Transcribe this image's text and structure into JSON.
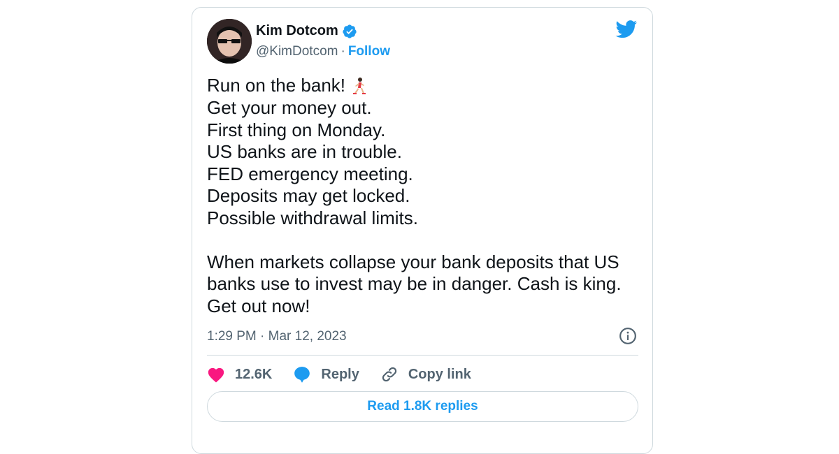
{
  "author": {
    "name": "Kim Dotcom",
    "handle": "@KimDotcom",
    "separator": "·",
    "follow_label": "Follow"
  },
  "tweet": {
    "lines": [
      "Run on the bank!",
      "Get your money out.",
      "First thing on Monday.",
      "US banks are in trouble.",
      "FED emergency meeting.",
      "Deposits may get locked.",
      "Possible withdrawal limits."
    ],
    "paragraph2": [
      "When markets collapse your bank deposits that US",
      "banks use to invest may be in danger. Cash is king.",
      "Get out now!"
    ],
    "emoji": "running-woman-emoji",
    "timestamp": "1:29 PM · Mar 12, 2023"
  },
  "actions": {
    "likes": "12.6K",
    "reply_label": "Reply",
    "copy_link_label": "Copy link"
  },
  "read_replies_label": "Read 1.8K replies",
  "icons": [
    "verified-badge-icon",
    "twitter-bird-icon",
    "info-icon",
    "heart-icon",
    "reply-bubble-icon",
    "link-icon"
  ],
  "colors": {
    "accent": "#1d9bf0",
    "heart": "#f91880",
    "text": "#0f1419",
    "muted": "#536471",
    "border": "#cfd9de"
  }
}
